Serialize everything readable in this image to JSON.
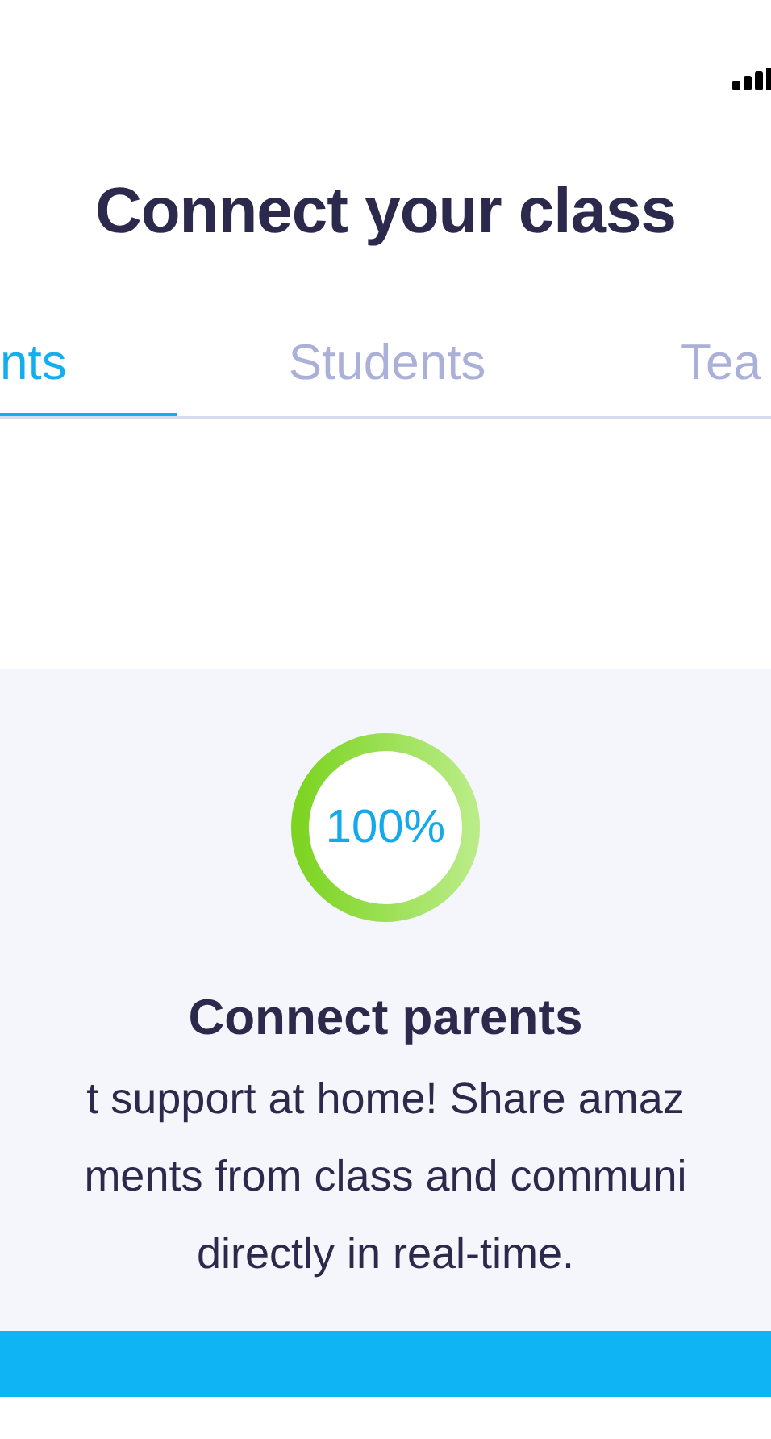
{
  "header": {
    "title": "Connect your class"
  },
  "tabs": [
    {
      "label": "nts",
      "selected": true
    },
    {
      "label": "Students",
      "selected": false
    },
    {
      "label": "Tea",
      "selected": false
    }
  ],
  "card": {
    "progress": {
      "level": 1.0,
      "reading": "100%"
    },
    "title": "Connect parents",
    "description_lines": [
      "t support at home! Share amaz",
      "ments from class and communi",
      "directly in real-time."
    ]
  }
}
